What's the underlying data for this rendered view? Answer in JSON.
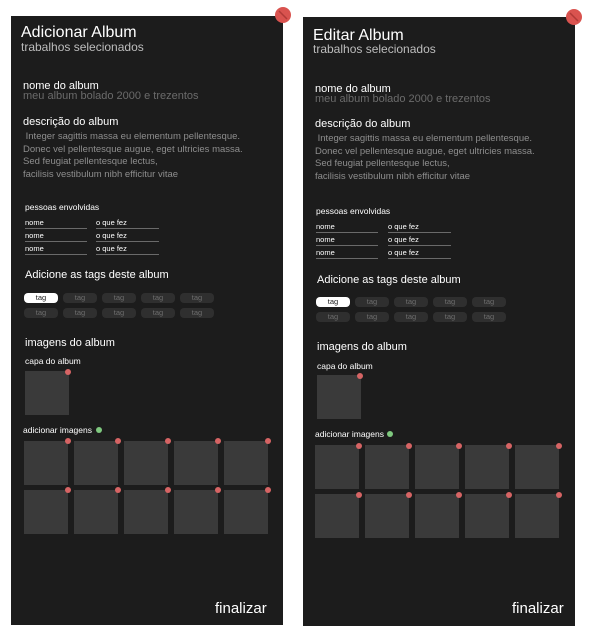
{
  "left": {
    "title": "Adicionar Album",
    "subtitle": "trabalhos selecionados",
    "name_label": "nome  do album",
    "name_placeholder": "meu album bolado 2000 e trezentos",
    "desc_label": "descrição do album",
    "desc_lines": [
      " Integer sagittis massa eu elementum pellentesque.",
      "Donec vel pellentesque augue, eget ultricies massa.",
      "Sed feugiat pellentesque lectus,",
      "facilisis vestibulum nibh efficitur vitae"
    ],
    "people_label": "pessoas envolvidas",
    "people": [
      {
        "name": "nome",
        "role": "o que fez"
      },
      {
        "name": "nome",
        "role": "o que fez"
      },
      {
        "name": "nome",
        "role": "o que fez"
      }
    ],
    "tags_label": "Adicione as tags deste album",
    "tags": [
      "tag",
      "tag",
      "tag",
      "tag",
      "tag",
      "tag",
      "tag",
      "tag",
      "tag",
      "tag"
    ],
    "images_label": "imagens do album",
    "cover_label": "capa do album",
    "add_images_label": "adicionar imagens",
    "finish": "finalizar"
  },
  "right": {
    "title": "Editar Album",
    "subtitle": "trabalhos selecionados",
    "name_label": "nome  do album",
    "name_placeholder": "meu album bolado 2000 e trezentos",
    "desc_label": "descrição do album",
    "desc_lines": [
      " Integer sagittis massa eu elementum pellentesque.",
      "Donec vel pellentesque augue, eget ultricies massa.",
      "Sed feugiat pellentesque lectus,",
      "facilisis vestibulum nibh efficitur vitae"
    ],
    "people_label": "pessoas envolvidas",
    "people": [
      {
        "name": "nome",
        "role": "o que fez"
      },
      {
        "name": "nome",
        "role": "o que fez"
      },
      {
        "name": "nome",
        "role": "o que fez"
      }
    ],
    "tags_label": "Adicione as tags deste album",
    "tags": [
      "tag",
      "tag",
      "tag",
      "tag",
      "tag",
      "tag",
      "tag",
      "tag",
      "tag",
      "tag"
    ],
    "images_label": "imagens do album",
    "cover_label": "capa do album",
    "add_images_label": "adicionar imagens",
    "finish": "finalizar"
  },
  "icons": {
    "close": "close-icon",
    "remove": "remove-dot-icon",
    "add": "add-dot-icon"
  },
  "colors": {
    "panel": "#1c1c1c",
    "close": "#d9534f",
    "remove": "#d66464",
    "add": "#7fc97f",
    "active_tag": "#ffffff"
  }
}
